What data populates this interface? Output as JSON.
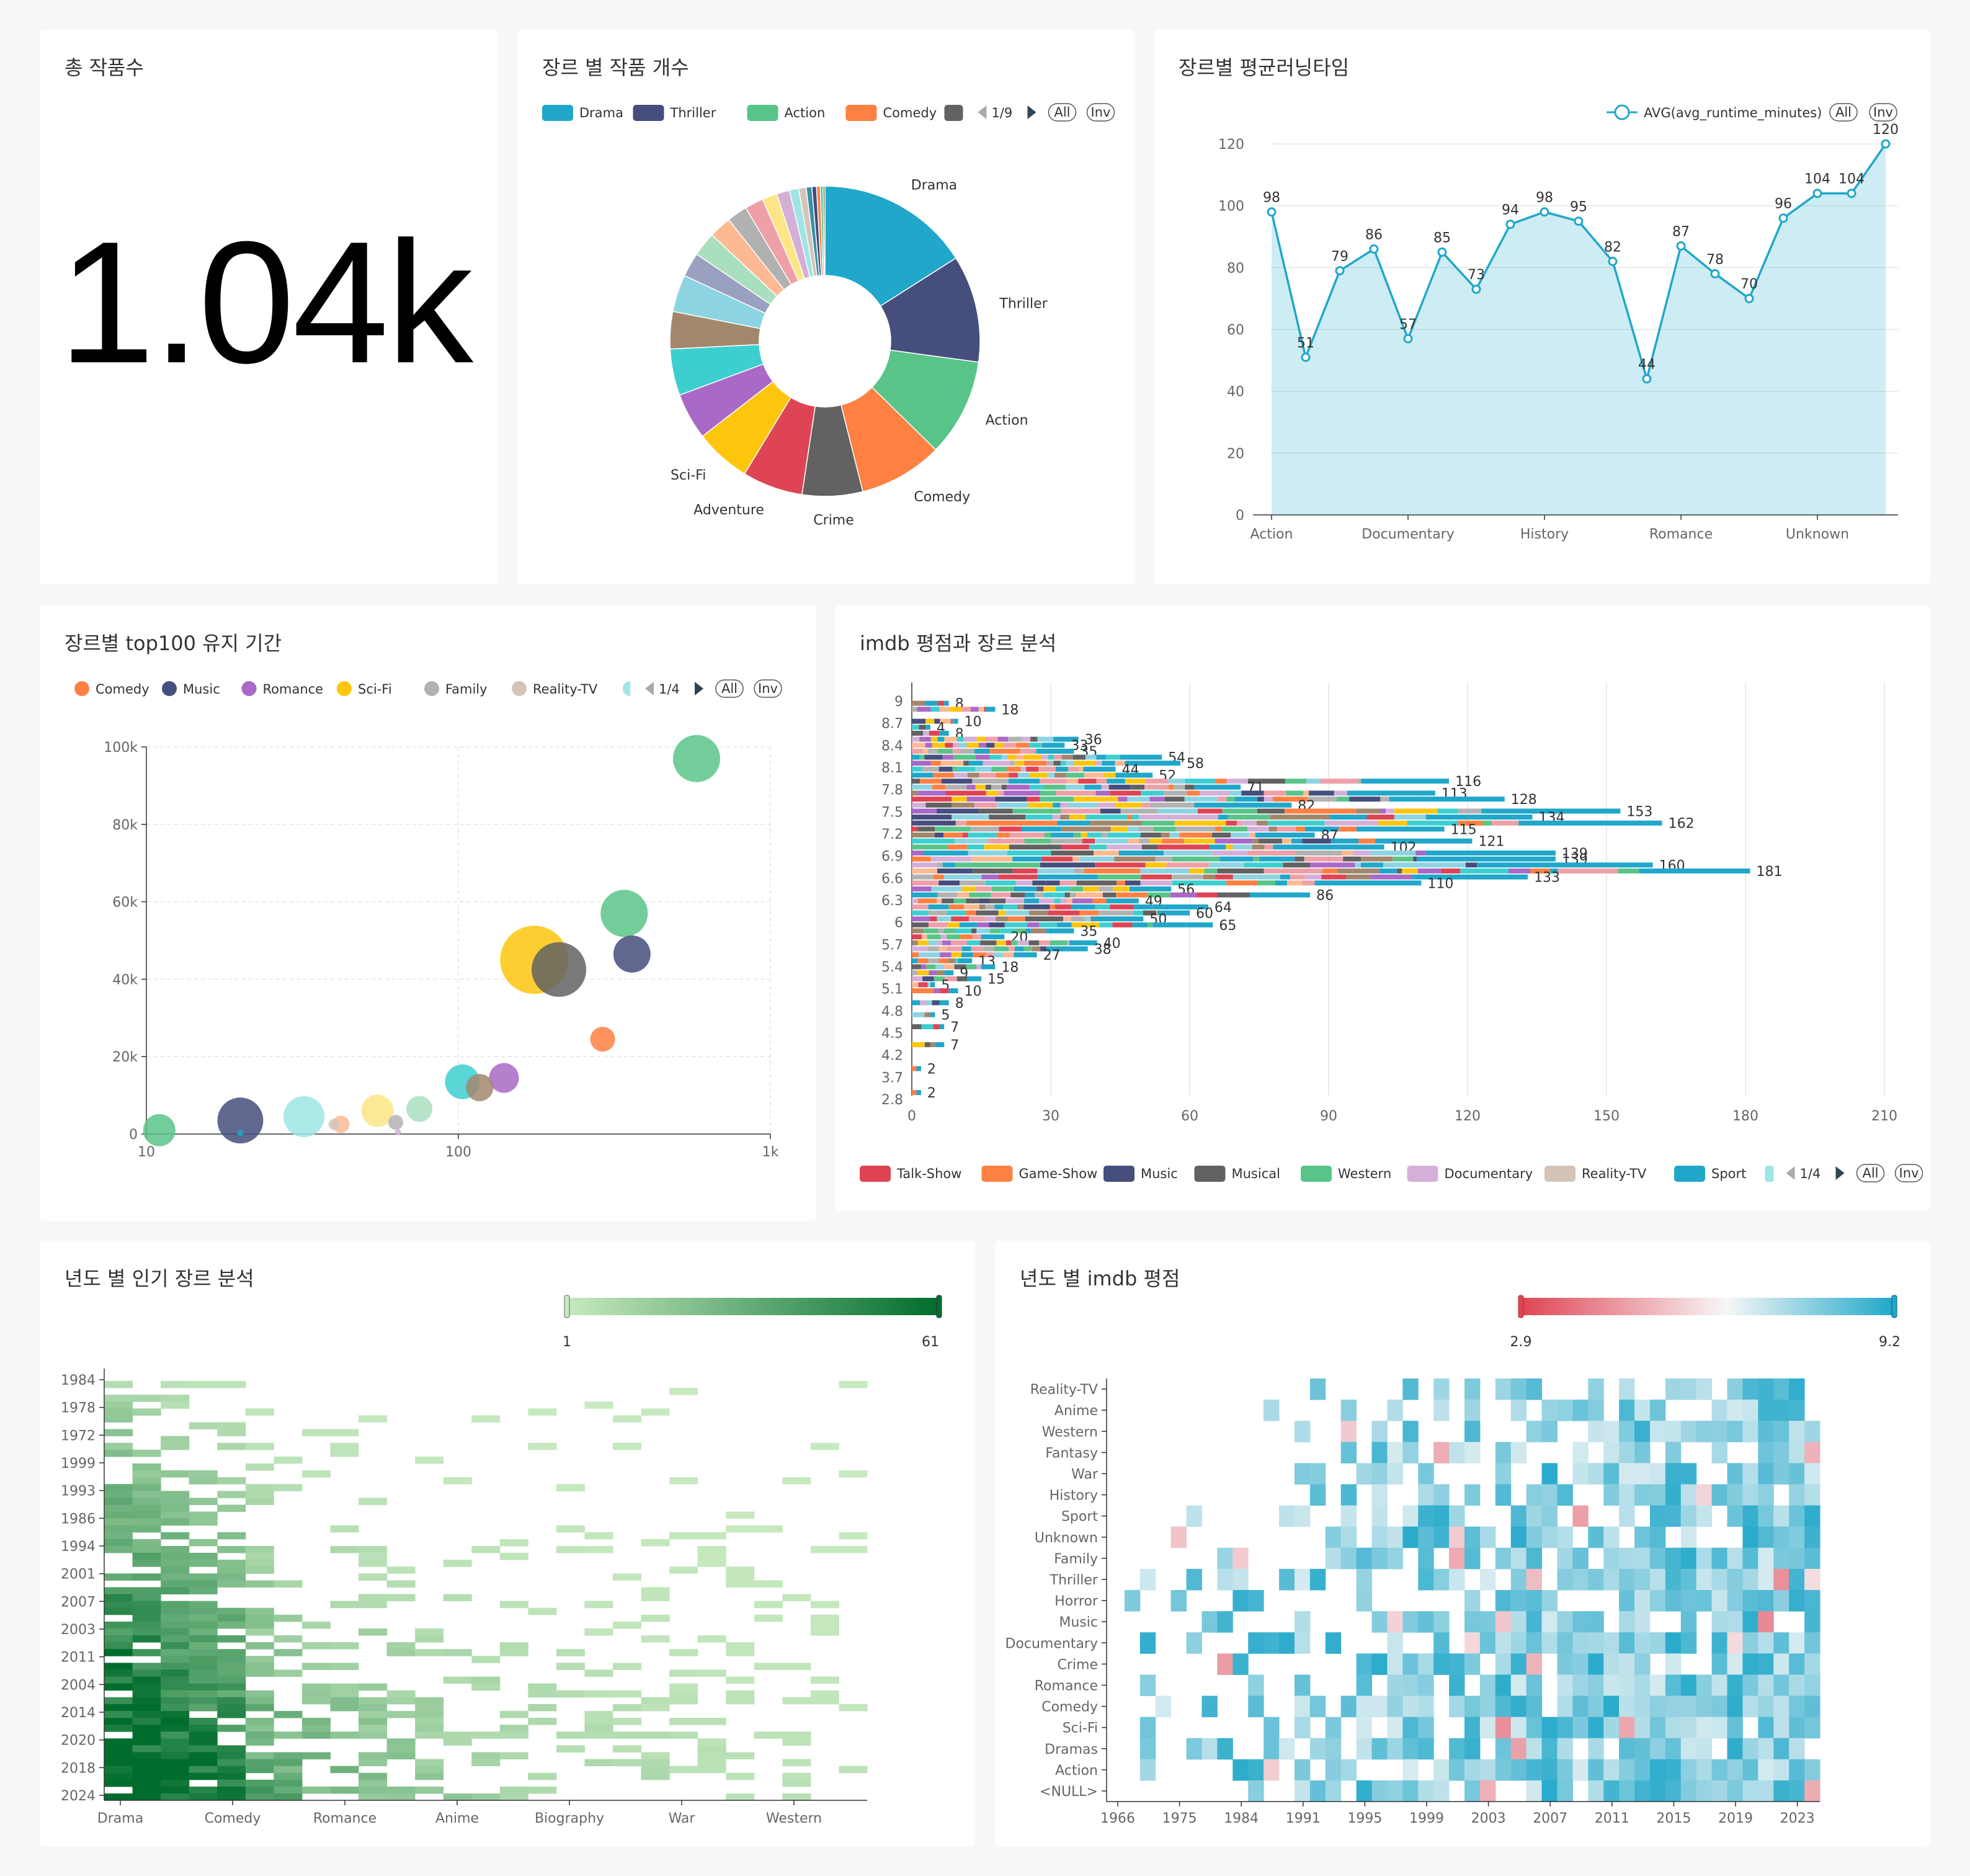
{
  "panels": {
    "total": {
      "title": "총 작품수",
      "value": "1.04k"
    },
    "pie": {
      "title": "장르 별 작품 개수"
    },
    "runtime": {
      "title": "장르별 평균러닝타임"
    },
    "top100": {
      "title": "장르별 top100 유지 기간"
    },
    "imdb_genre": {
      "title": "imdb 평점과 장르 분석"
    },
    "year_genre": {
      "title": "년도 별 인기 장르 분석"
    },
    "year_imdb": {
      "title": "년도 별 imdb 평점"
    }
  },
  "colors": {
    "Drama": "#20a7c9",
    "Thriller": "#454e7c",
    "Action": "#59c488",
    "Comedy": "#fe8042",
    "Crime": "#626262",
    "Adventure": "#df4454",
    "Sci-Fi": "#fdc60d",
    "Romance": "#a969c6",
    "Music": "#454e7c",
    "Family": "#b2b2b2",
    "Reality-TV": "#d4c4b8",
    "Talk-Show": "#df4454",
    "Game-Show": "#fe8042",
    "Musical": "#626262",
    "Western": "#59c488",
    "Documentary": "#d4b0d8",
    "Sport": "#20a7c9"
  },
  "chart_data": [
    {
      "id": "pie",
      "type": "pie",
      "legend": {
        "items": [
          "Drama",
          "Thriller",
          "Action",
          "Comedy"
        ],
        "page": "1/9",
        "buttons": [
          "All",
          "Inv"
        ]
      },
      "slices": [
        {
          "label": "Drama",
          "value": 16.5,
          "color": "#20a7c9"
        },
        {
          "label": "Thriller",
          "value": 11.5,
          "color": "#454e7c"
        },
        {
          "label": "Action",
          "value": 10.5,
          "color": "#59c488"
        },
        {
          "label": "Comedy",
          "value": 9.0,
          "color": "#fe8042"
        },
        {
          "label": "Crime",
          "value": 6.5,
          "color": "#626262"
        },
        {
          "label": "Adventure",
          "value": 6.5,
          "color": "#df4454"
        },
        {
          "label": "Sci-Fi",
          "value": 6.0,
          "color": "#fdc60d"
        },
        {
          "label": "",
          "value": 5.0,
          "color": "#a969c6"
        },
        {
          "label": "",
          "value": 5.0,
          "color": "#3dcfcf"
        },
        {
          "label": "",
          "value": 4.0,
          "color": "#a2876d"
        },
        {
          "label": "",
          "value": 4.0,
          "color": "#8dd4e2"
        },
        {
          "label": "",
          "value": 2.6,
          "color": "#9aa1c0"
        },
        {
          "label": "",
          "value": 2.6,
          "color": "#a9dfbf"
        },
        {
          "label": "",
          "value": 2.4,
          "color": "#fdb992"
        },
        {
          "label": "",
          "value": 2.2,
          "color": "#b1b1b1"
        },
        {
          "label": "",
          "value": 2.0,
          "color": "#eea0a8"
        },
        {
          "label": "",
          "value": 1.6,
          "color": "#fde686"
        },
        {
          "label": "",
          "value": 1.4,
          "color": "#d4b0d8"
        },
        {
          "label": "",
          "value": 1.0,
          "color": "#9ee5e5"
        },
        {
          "label": "",
          "value": 0.8,
          "color": "#d4c4b8"
        },
        {
          "label": "",
          "value": 0.6,
          "color": "#3a8fa8"
        },
        {
          "label": "",
          "value": 0.5,
          "color": "#454e7c"
        },
        {
          "label": "",
          "value": 0.4,
          "color": "#fe8042"
        },
        {
          "label": "",
          "value": 0.3,
          "color": "#59c488"
        },
        {
          "label": "",
          "value": 0.2,
          "color": "#626262"
        }
      ]
    },
    {
      "id": "runtime",
      "type": "area",
      "legend": {
        "label": "AVG(avg_runtime_minutes)",
        "buttons": [
          "All",
          "Inv"
        ]
      },
      "values": [
        98,
        51,
        79,
        86,
        57,
        85,
        73,
        94,
        98,
        95,
        82,
        44,
        87,
        78,
        70,
        96,
        104,
        104,
        120
      ],
      "xticks": [
        {
          "i": 0,
          "label": "Action"
        },
        {
          "i": 4,
          "label": "Documentary"
        },
        {
          "i": 8,
          "label": "History"
        },
        {
          "i": 12,
          "label": "Romance"
        },
        {
          "i": 16,
          "label": "Unknown"
        }
      ],
      "ylim": [
        0,
        120
      ],
      "yticks": [
        0,
        20,
        40,
        60,
        80,
        100,
        120
      ]
    },
    {
      "id": "top100",
      "type": "scatter",
      "xscale": "log",
      "xlim": [
        10,
        1000
      ],
      "xticks": [
        {
          "v": 10,
          "label": "10"
        },
        {
          "v": 100,
          "label": "100"
        },
        {
          "v": 1000,
          "label": "1k"
        }
      ],
      "ylim": [
        0,
        100000
      ],
      "yticks": [
        {
          "v": 0,
          "label": "0"
        },
        {
          "v": 20000,
          "label": "20k"
        },
        {
          "v": 40000,
          "label": "40k"
        },
        {
          "v": 60000,
          "label": "60k"
        },
        {
          "v": 80000,
          "label": "80k"
        },
        {
          "v": 100000,
          "label": "100k"
        }
      ],
      "legend": {
        "items": [
          {
            "name": "Comedy",
            "color": "#fe8042"
          },
          {
            "name": "Music",
            "color": "#454e7c"
          },
          {
            "name": "Romance",
            "color": "#a969c6"
          },
          {
            "name": "Sci-Fi",
            "color": "#fdc60d"
          },
          {
            "name": "Family",
            "color": "#b2b2b2"
          },
          {
            "name": "Reality-TV",
            "color": "#d4c4b8"
          }
        ],
        "page": "1/4",
        "buttons": [
          "All",
          "Inv"
        ]
      },
      "points": [
        {
          "x": 11,
          "y": 1000,
          "s": 26,
          "c": "#59c488"
        },
        {
          "x": 20,
          "y": 3500,
          "s": 37,
          "c": "#454e7c"
        },
        {
          "x": 20,
          "y": 300,
          "s": 5,
          "c": "#20a7c9"
        },
        {
          "x": 32,
          "y": 4500,
          "s": 33,
          "c": "#9ee5e5"
        },
        {
          "x": 40,
          "y": 2500,
          "s": 9,
          "c": "#d4c4b8"
        },
        {
          "x": 42,
          "y": 2500,
          "s": 14,
          "c": "#fdb992"
        },
        {
          "x": 55,
          "y": 6000,
          "s": 26,
          "c": "#fde686"
        },
        {
          "x": 63,
          "y": 3000,
          "s": 12,
          "c": "#b2b2b2"
        },
        {
          "x": 64,
          "y": 500,
          "s": 5,
          "c": "#d4b0d8"
        },
        {
          "x": 75,
          "y": 6500,
          "s": 21,
          "c": "#a9dfbf"
        },
        {
          "x": 103,
          "y": 13500,
          "s": 28,
          "c": "#3dcfcf"
        },
        {
          "x": 117,
          "y": 12000,
          "s": 22,
          "c": "#a2876d"
        },
        {
          "x": 140,
          "y": 14500,
          "s": 24,
          "c": "#a969c6"
        },
        {
          "x": 175,
          "y": 45000,
          "s": 55,
          "c": "#fdc60d"
        },
        {
          "x": 210,
          "y": 42500,
          "s": 44,
          "c": "#626262"
        },
        {
          "x": 290,
          "y": 24500,
          "s": 20,
          "c": "#fe8042"
        },
        {
          "x": 340,
          "y": 57000,
          "s": 38,
          "c": "#59c488"
        },
        {
          "x": 360,
          "y": 46500,
          "s": 30,
          "c": "#454e7c"
        },
        {
          "x": 580,
          "y": 97000,
          "s": 38,
          "c": "#59c488"
        }
      ]
    },
    {
      "id": "imdb_genre",
      "type": "bar",
      "stacked": true,
      "orientation": "horizontal",
      "xlim": [
        0,
        210
      ],
      "xticks": [
        0,
        30,
        60,
        90,
        120,
        150,
        180,
        210
      ],
      "ytick_labels": [
        "9",
        "8.7",
        "8.4",
        "8.1",
        "7.8",
        "7.5",
        "7.2",
        "6.9",
        "6.6",
        "6.3",
        "6",
        "5.7",
        "5.4",
        "5.1",
        "4.8",
        "4.5",
        "4.2",
        "3.7",
        "2.8"
      ],
      "rows": [
        {
          "y": 9.3,
          "total": 8
        },
        {
          "y": 9.2,
          "total": 18
        },
        {
          "y": 9.0,
          "total": 10
        },
        {
          "y": 8.9,
          "total": 4
        },
        {
          "y": 8.8,
          "total": 8
        },
        {
          "y": 8.7,
          "total": 36
        },
        {
          "y": 8.6,
          "total": 33
        },
        {
          "y": 8.5,
          "total": 35
        },
        {
          "y": 8.4,
          "total": 54
        },
        {
          "y": 8.3,
          "total": 58
        },
        {
          "y": 8.2,
          "total": 44
        },
        {
          "y": 8.1,
          "total": 52
        },
        {
          "y": 8.0,
          "total": 116
        },
        {
          "y": 7.9,
          "total": 71
        },
        {
          "y": 7.8,
          "total": 113
        },
        {
          "y": 7.7,
          "total": 128
        },
        {
          "y": 7.6,
          "total": 82
        },
        {
          "y": 7.5,
          "total": 153
        },
        {
          "y": 7.4,
          "total": 134
        },
        {
          "y": 7.3,
          "total": 162
        },
        {
          "y": 7.2,
          "total": 115
        },
        {
          "y": 7.1,
          "total": 87
        },
        {
          "y": 7.0,
          "total": 121
        },
        {
          "y": 6.9,
          "total": 102
        },
        {
          "y": 6.8,
          "total": 139
        },
        {
          "y": 6.7,
          "total": 139
        },
        {
          "y": 6.6,
          "total": 160
        },
        {
          "y": 6.5,
          "total": 181
        },
        {
          "y": 6.4,
          "total": 133
        },
        {
          "y": 6.3,
          "total": 110
        },
        {
          "y": 6.2,
          "total": 56
        },
        {
          "y": 6.1,
          "total": 86
        },
        {
          "y": 6.0,
          "total": 49
        },
        {
          "y": 5.9,
          "total": 64
        },
        {
          "y": 5.8,
          "total": 60
        },
        {
          "y": 5.7,
          "total": 50
        },
        {
          "y": 5.6,
          "total": 65
        },
        {
          "y": 5.5,
          "total": 35
        },
        {
          "y": 5.4,
          "total": 20
        },
        {
          "y": 5.3,
          "total": 40
        },
        {
          "y": 5.2,
          "total": 38
        },
        {
          "y": 5.1,
          "total": 27
        },
        {
          "y": 5.0,
          "total": 13
        },
        {
          "y": 4.9,
          "total": 18
        },
        {
          "y": 4.8,
          "total": 9
        },
        {
          "y": 4.7,
          "total": 15
        },
        {
          "y": 4.6,
          "total": 5
        },
        {
          "y": 4.5,
          "total": 10
        },
        {
          "y": 4.3,
          "total": 8
        },
        {
          "y": 4.1,
          "total": 5
        },
        {
          "y": 3.9,
          "total": 7
        },
        {
          "y": 3.6,
          "total": 7
        },
        {
          "y": 3.2,
          "total": 2
        },
        {
          "y": 2.8,
          "total": 2
        }
      ],
      "legend": {
        "items": [
          {
            "name": "Talk-Show",
            "color": "#df4454"
          },
          {
            "name": "Game-Show",
            "color": "#fe8042"
          },
          {
            "name": "Music",
            "color": "#454e7c"
          },
          {
            "name": "Musical",
            "color": "#626262"
          },
          {
            "name": "Western",
            "color": "#59c488"
          },
          {
            "name": "Documentary",
            "color": "#d4b0d8"
          },
          {
            "name": "Reality-TV",
            "color": "#d4c4b8"
          },
          {
            "name": "Sport",
            "color": "#20a7c9"
          }
        ],
        "page": "1/4",
        "buttons": [
          "All",
          "Inv"
        ]
      }
    },
    {
      "id": "year_genre",
      "type": "heatmap",
      "visual_map": {
        "min": 1,
        "max": 61,
        "min_label": "1",
        "max_label": "61",
        "colors": [
          "#c7e9c0",
          "#006d2c"
        ]
      },
      "y_labels": [
        "1984",
        "1978",
        "1972",
        "1999",
        "1993",
        "1986",
        "1994",
        "2001",
        "2007",
        "2003",
        "2011",
        "2004",
        "2014",
        "2020",
        "2018",
        "2024"
      ],
      "x_labels": [
        "Drama",
        "Comedy",
        "Romance",
        "Anime",
        "Biography",
        "War",
        "Western"
      ]
    },
    {
      "id": "year_imdb",
      "type": "heatmap",
      "visual_map": {
        "min": 2.9,
        "max": 9.2,
        "min_label": "2.9",
        "max_label": "9.2",
        "colors": [
          "#df4454",
          "#f7f7f7",
          "#20a7c9"
        ]
      },
      "y_labels": [
        "Reality-TV",
        "Anime",
        "Western",
        "Fantasy",
        "War",
        "History",
        "Sport",
        "Unknown",
        "Family",
        "Thriller",
        "Horror",
        "Music",
        "Documentary",
        "Crime",
        "Romance",
        "Comedy",
        "Sci-Fi",
        "Dramas",
        "Action",
        "<NULL>"
      ],
      "x_labels": [
        "1966",
        "1975",
        "1984",
        "1991",
        "1995",
        "1999",
        "2003",
        "2007",
        "2011",
        "2015",
        "2019",
        "2023"
      ]
    }
  ]
}
